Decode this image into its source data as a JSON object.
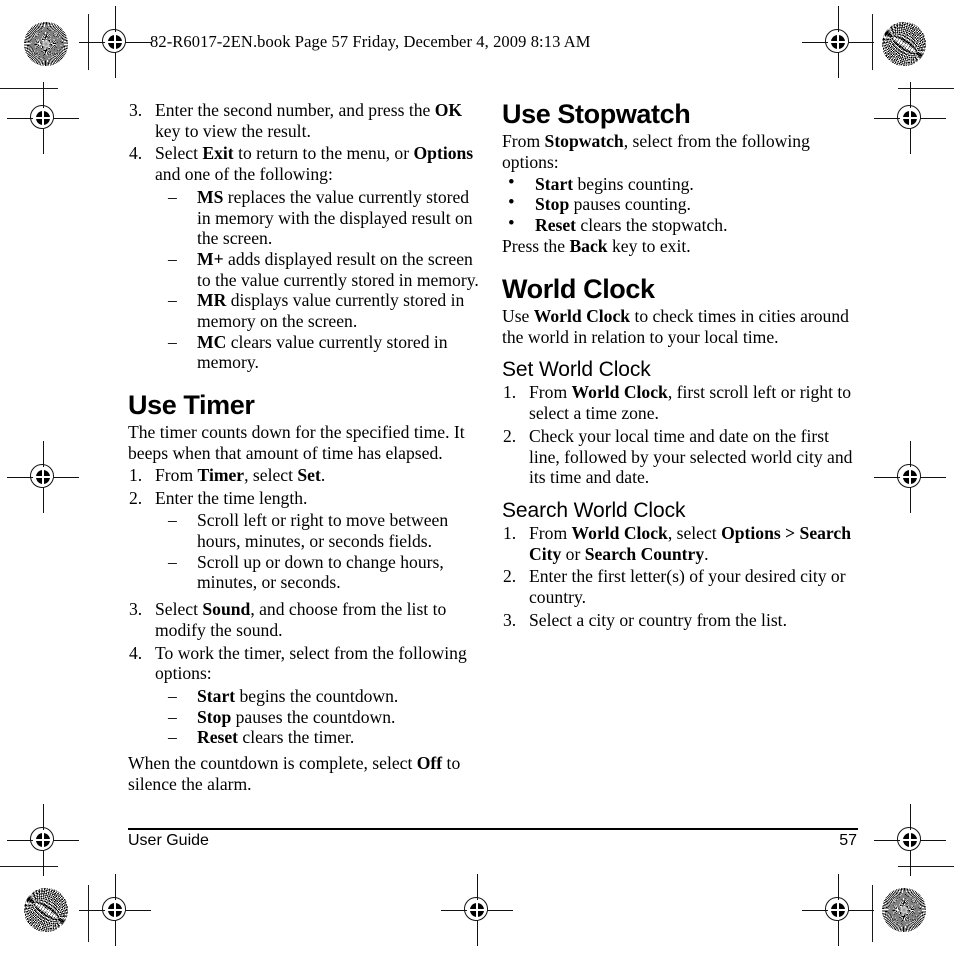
{
  "page": {
    "book_header": "82-R6017-2EN.book  Page 57  Friday, December 4, 2009  8:13 AM",
    "footer_left": "User Guide",
    "footer_page_number": "57",
    "ink_color": "#000000",
    "paper_color": "#ffffff"
  },
  "marks": {
    "starburst_icon": "starburst-pattern-circle",
    "moire_icon": "moire-pattern-circle",
    "registration_icon": "registration-target-mark"
  },
  "left_column": {
    "continued_list": {
      "items": [
        {
          "marker": "3.",
          "text_html": "Enter the second number, and press the <b>OK</b> key to view the result."
        },
        {
          "marker": "4.",
          "text_html": "Select <b>Exit</b> to return to the menu, or <b>Options</b> and one of the following:"
        }
      ],
      "sub_items": [
        {
          "marker": "–",
          "text_html": "<b>MS</b> replaces the value currently stored in memory with the displayed result on the screen."
        },
        {
          "marker": "–",
          "text_html": "<b>M+</b> adds displayed result on the screen to the value currently stored in memory."
        },
        {
          "marker": "–",
          "text_html": "<b>MR</b> displays value currently stored in memory on the screen."
        },
        {
          "marker": "–",
          "text_html": "<b>MC</b> clears value currently stored in memory."
        }
      ]
    },
    "use_timer": {
      "heading": "Use Timer",
      "intro": "The timer counts down for the specified time. It beeps when that amount of time has elapsed.",
      "steps": [
        {
          "marker": "1.",
          "text_html": "From <b>Timer</b>, select <b>Set</b>."
        },
        {
          "marker": "2.",
          "text_html": "Enter the time length."
        }
      ],
      "step2_subitems": [
        {
          "marker": "–",
          "text_html": "Scroll left or right to move between hours, minutes, or seconds fields."
        },
        {
          "marker": "–",
          "text_html": "Scroll up or down to change hours, minutes, or seconds."
        }
      ],
      "steps_cont": [
        {
          "marker": "3.",
          "text_html": "Select <b>Sound</b>, and choose from the list to modify the sound."
        },
        {
          "marker": "4.",
          "text_html": "To work the timer, select from the following options:"
        }
      ],
      "step4_subitems": [
        {
          "marker": "–",
          "text_html": "<b>Start</b> begins the countdown."
        },
        {
          "marker": "–",
          "text_html": "<b>Stop</b> pauses the countdown."
        },
        {
          "marker": "–",
          "text_html": "<b>Reset</b> clears the timer."
        }
      ],
      "closing": "When the countdown is complete, select <b>Off</b> to silence the alarm."
    }
  },
  "right_column": {
    "use_stopwatch": {
      "heading": "Use Stopwatch",
      "intro": "From <b>Stopwatch</b>, select from the following options:",
      "options": [
        {
          "marker": "•",
          "text_html": "<b>Start</b> begins counting."
        },
        {
          "marker": "•",
          "text_html": "<b>Stop</b> pauses counting."
        },
        {
          "marker": "•",
          "text_html": "<b>Reset</b> clears the stopwatch."
        }
      ],
      "closing": "Press the <b>Back</b> key to exit."
    },
    "world_clock": {
      "heading": "World Clock",
      "intro": "Use <b>World Clock</b> to check times in cities around the world in relation to your local time.",
      "set_world_clock": {
        "heading": "Set World Clock",
        "steps": [
          {
            "marker": "1.",
            "text_html": "From <b>World Clock</b>, first scroll left or right to select a time zone."
          },
          {
            "marker": "2.",
            "text_html": "Check your local time and date on the first line, followed by your selected world city and its time and date."
          }
        ]
      },
      "search_world_clock": {
        "heading": "Search World Clock",
        "steps": [
          {
            "marker": "1.",
            "text_html": "From <b>World Clock</b>, select <b>Options &gt; Search City</b> or <b>Search Country</b>."
          },
          {
            "marker": "2.",
            "text_html": "Enter the first letter(s) of your desired city or country."
          },
          {
            "marker": "3.",
            "text_html": "Select a city or country from the list."
          }
        ]
      }
    }
  }
}
